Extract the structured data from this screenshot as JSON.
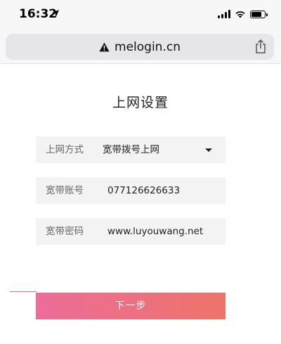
{
  "status_bar": {
    "time": "16:32",
    "location_icon": "location-arrow-icon",
    "signal_icon": "cellular-signal-icon",
    "wifi_icon": "wifi-icon",
    "battery_icon": "battery-icon",
    "battery_level": 0.85
  },
  "browser": {
    "url": "melogin.cn",
    "warning_icon": "not-secure-warning-icon",
    "share_icon": "share-icon"
  },
  "page": {
    "title": "上网设置",
    "connection_type": {
      "label": "上网方式",
      "value": "宽带拨号上网"
    },
    "account": {
      "label": "宽带账号",
      "value": "077126626633"
    },
    "password": {
      "label": "宽带密码",
      "value": "www.luyouwang.net"
    },
    "next_button": "下一步"
  },
  "colors": {
    "button_gradient_start": "#ec6d9a",
    "button_gradient_end": "#ee7369",
    "field_background": "#f3f3f4"
  }
}
